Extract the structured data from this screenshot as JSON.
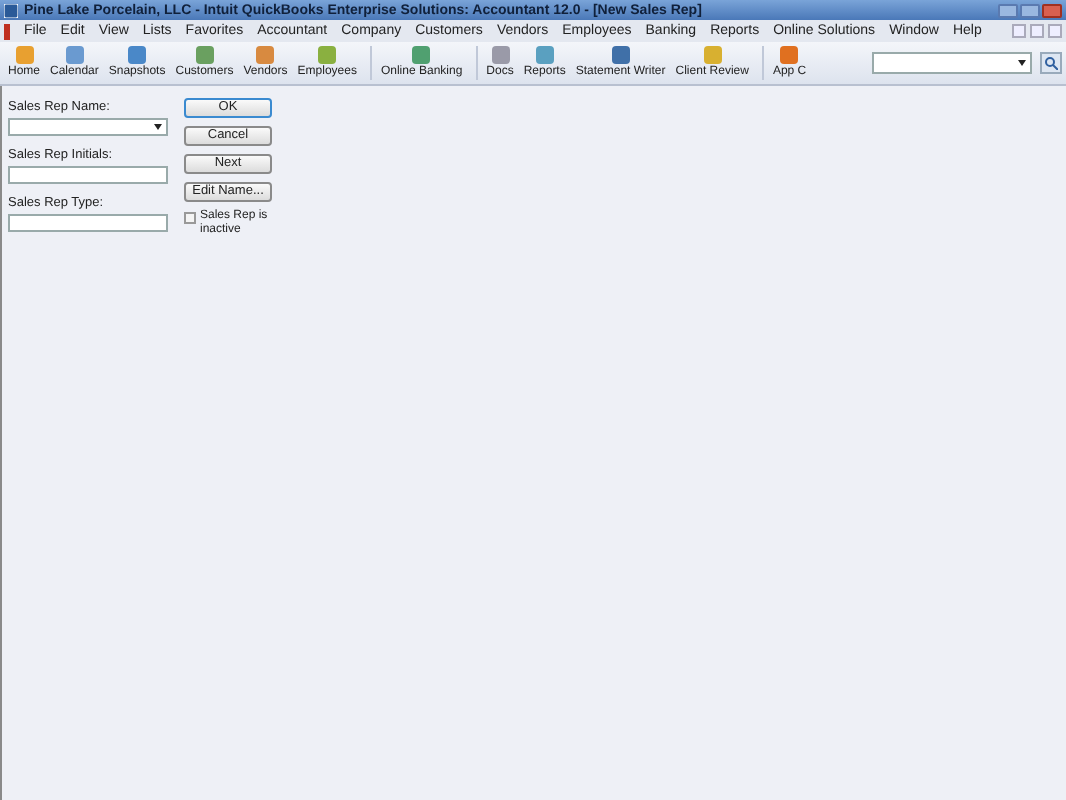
{
  "window": {
    "title": "Pine Lake Porcelain, LLC  - Intuit QuickBooks Enterprise Solutions: Accountant 12.0 - [New Sales Rep]"
  },
  "menu": [
    "File",
    "Edit",
    "View",
    "Lists",
    "Favorites",
    "Accountant",
    "Company",
    "Customers",
    "Vendors",
    "Employees",
    "Banking",
    "Reports",
    "Online Solutions",
    "Window",
    "Help"
  ],
  "toolbar": [
    {
      "label": "Home",
      "color": "#e8a030"
    },
    {
      "label": "Calendar",
      "color": "#6a9ad0"
    },
    {
      "label": "Snapshots",
      "color": "#4a88c8"
    },
    {
      "label": "Customers",
      "color": "#6aa060"
    },
    {
      "label": "Vendors",
      "color": "#d88a40"
    },
    {
      "label": "Employees",
      "color": "#8ab040"
    },
    {
      "label": "Online Banking",
      "color": "#50a070"
    },
    {
      "label": "Docs",
      "color": "#9a9aa8"
    },
    {
      "label": "Reports",
      "color": "#5aa0c0"
    },
    {
      "label": "Statement Writer",
      "color": "#4070a8"
    },
    {
      "label": "Client Review",
      "color": "#d8b030"
    },
    {
      "label": "App C",
      "color": "#e07020"
    }
  ],
  "form": {
    "fields": [
      {
        "label": "Sales Rep Name:",
        "kind": "dropdown"
      },
      {
        "label": "Sales Rep Initials:",
        "kind": "text"
      },
      {
        "label": "Sales Rep Type:",
        "kind": "text"
      }
    ],
    "buttons": [
      {
        "label": "OK",
        "selected": true
      },
      {
        "label": "Cancel",
        "selected": false
      },
      {
        "label": "Next",
        "selected": false
      },
      {
        "label": "Edit Name...",
        "selected": false
      }
    ],
    "inactive": {
      "label": "Sales Rep is inactive",
      "checked": false
    }
  }
}
